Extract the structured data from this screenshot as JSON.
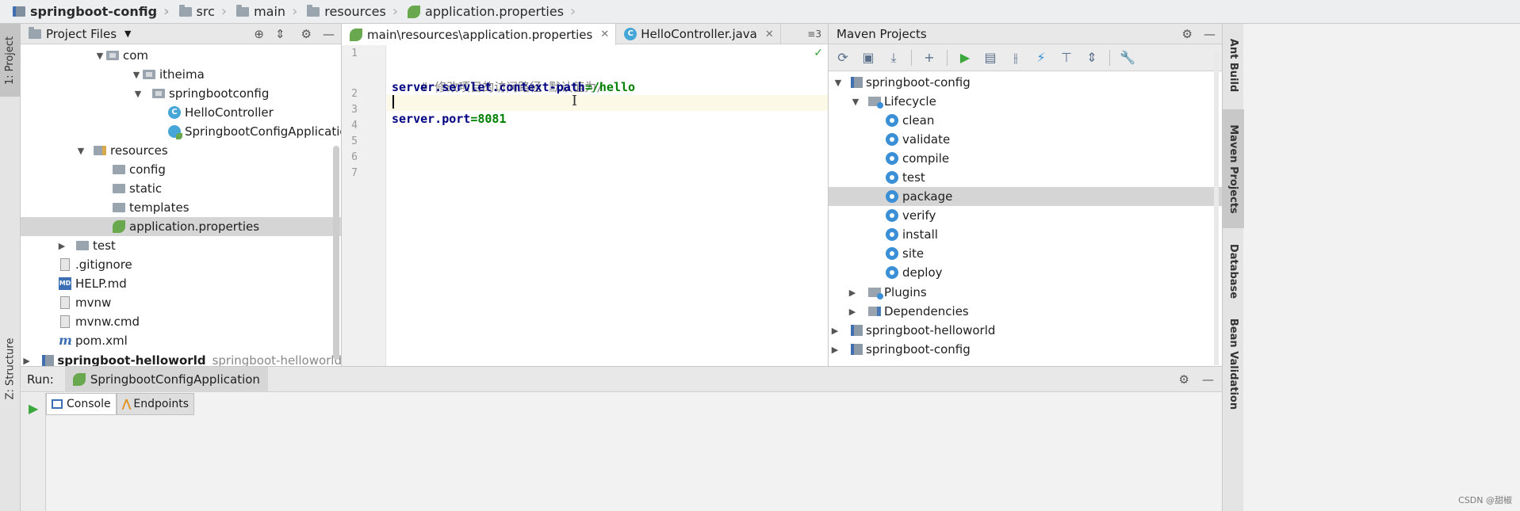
{
  "breadcrumb": {
    "items": [
      {
        "label": "springboot-config"
      },
      {
        "label": "src"
      },
      {
        "label": "main"
      },
      {
        "label": "resources"
      },
      {
        "label": "application.properties"
      }
    ]
  },
  "left_stripe": {
    "project_tab": "1: Project",
    "structure_tab": "Z: Structure"
  },
  "project_panel": {
    "title": "Project Files",
    "tree": [
      {
        "label": "com"
      },
      {
        "label": "itheima"
      },
      {
        "label": "springbootconfig"
      },
      {
        "label": "HelloController"
      },
      {
        "label": "SpringbootConfigApplication"
      },
      {
        "label": "resources"
      },
      {
        "label": "config"
      },
      {
        "label": "static"
      },
      {
        "label": "templates"
      },
      {
        "label": "application.properties"
      },
      {
        "label": "test"
      },
      {
        "label": ".gitignore"
      },
      {
        "label": "HELP.md"
      },
      {
        "label": "mvnw"
      },
      {
        "label": "mvnw.cmd"
      },
      {
        "label": "pom.xml"
      },
      {
        "label": "springboot-helloworld",
        "secondary": "springboot-helloworld"
      }
    ]
  },
  "editor": {
    "tabs": [
      {
        "label": "main\\resources\\application.properties"
      },
      {
        "label": "HelloController.java"
      }
    ],
    "tab_overflow": "≡3",
    "lines": [
      {
        "num": "1",
        "comment": "",
        "key": "",
        "value": ""
      },
      {
        "num": "2",
        "comment": "# 修改项目的访问路径 默认值为/",
        "key": "",
        "value": ""
      },
      {
        "num": "3",
        "comment": "",
        "key": "server.servlet.context-path",
        "value": "=/hello"
      },
      {
        "num": "4",
        "comment": "",
        "key": "",
        "value": ""
      },
      {
        "num": "5",
        "comment": "",
        "key": "server.port",
        "value": "=8081"
      },
      {
        "num": "6",
        "comment": "",
        "key": "",
        "value": ""
      },
      {
        "num": "7",
        "comment": "",
        "key": "",
        "value": ""
      }
    ]
  },
  "maven_panel": {
    "title": "Maven Projects",
    "tree": [
      {
        "label": "springboot-config"
      },
      {
        "label": "Lifecycle"
      },
      {
        "label": "clean"
      },
      {
        "label": "validate"
      },
      {
        "label": "compile"
      },
      {
        "label": "test"
      },
      {
        "label": "package"
      },
      {
        "label": "verify"
      },
      {
        "label": "install"
      },
      {
        "label": "site"
      },
      {
        "label": "deploy"
      },
      {
        "label": "Plugins"
      },
      {
        "label": "Dependencies"
      },
      {
        "label": "springboot-helloworld"
      },
      {
        "label": "springboot-config"
      }
    ]
  },
  "right_stripe": {
    "ant_build": "Ant Build",
    "maven_projects": "Maven Projects",
    "database": "Database",
    "bean_validation": "Bean Validation"
  },
  "run_panel": {
    "label": "Run:",
    "config_name": "SpringbootConfigApplication",
    "console_tab": "Console",
    "endpoints_tab": "Endpoints"
  },
  "watermark": "CSDN @甜椒"
}
